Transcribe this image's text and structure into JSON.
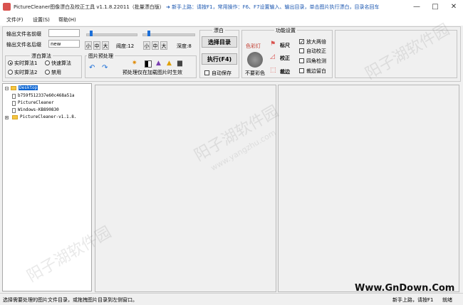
{
  "window": {
    "title": "PictureCleaner图像漂白及校正工具 v1.1.8.22011（批量漂白版）",
    "hint": "➜ 新手上路：请按F1，常用操作：F6、F7设置输入、输出目录，单击图片执行漂白，目录名回车",
    "controls": [
      "—",
      "□",
      "✕"
    ]
  },
  "menu": [
    "文件(F)",
    "设置(S)",
    "帮助(H)"
  ],
  "output": {
    "prefix_label": "输出文件名前缀",
    "prefix_value": "",
    "suffix_label": "输出文件名后缀",
    "suffix_value": "new"
  },
  "bleach_algo": {
    "title": "漂白算法",
    "options": [
      {
        "label": "实时算法1",
        "selected": true
      },
      {
        "label": "快速算法",
        "selected": false
      },
      {
        "label": "实时算法2",
        "selected": false
      },
      {
        "label": "禁用",
        "selected": false
      }
    ]
  },
  "sliders": {
    "sizes": [
      "小",
      "中",
      "大"
    ],
    "brightness_label": "阈度:12",
    "depth_label": "深度:8"
  },
  "preprocess": {
    "title": "图片预处理",
    "note": "预处理仅在加载图片时生效"
  },
  "bleach": {
    "title": "漂白",
    "select_dir": "选择目录",
    "execute": "执行(F4)",
    "autosave": "自动保存",
    "autosave_checked": false
  },
  "features": {
    "title": "功能设置",
    "color_light": "色彩灯",
    "ruler": "标尺",
    "correct": "校正",
    "no_color": "不要彩色",
    "crop": "裁边",
    "checkboxes": [
      {
        "label": "放大两倍",
        "checked": true
      },
      {
        "label": "自动校正",
        "checked": false
      },
      {
        "label": "四角检测",
        "checked": false
      },
      {
        "label": "裁边留白",
        "checked": false
      }
    ]
  },
  "tree": {
    "items": [
      {
        "label": "Desktop",
        "level": 0,
        "type": "folder",
        "selected": true,
        "expander": "−"
      },
      {
        "label": "b759f512337e60c468a51a",
        "level": 1,
        "type": "file"
      },
      {
        "label": "PictureCleaner",
        "level": 1,
        "type": "file"
      },
      {
        "label": "Windows-KB890830",
        "level": 1,
        "type": "file"
      },
      {
        "label": "PictureCleaner-v1.1.8.",
        "level": 1,
        "type": "folder",
        "expander": "+"
      }
    ]
  },
  "status": {
    "left": "选择需要处理的图片文件目录，或拖拽图片目录到左侧窗口。",
    "right_hint": "新手上路，请按F1",
    "state": "就绪"
  },
  "watermark": {
    "site": "Www.GnDown.Com",
    "cn": "阳子湖软件园",
    "url": "www.yangzhu.com"
  },
  "colors": {
    "accent_blue": "#1c6fd8",
    "hint_blue": "#1a56b0",
    "icon_red": "#d9534f"
  }
}
